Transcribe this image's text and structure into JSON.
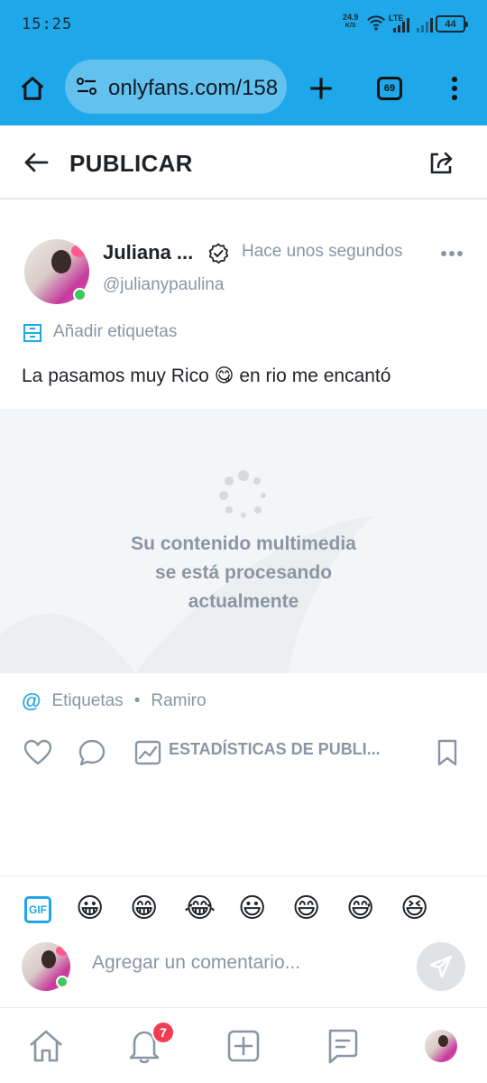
{
  "status_bar": {
    "time": "15:25",
    "net_speed": "24.9",
    "net_unit": "K/S",
    "network_type": "LTE",
    "battery": "44"
  },
  "browser": {
    "url": "onlyfans.com/158",
    "tab_count": "69",
    "icons": [
      "home-icon",
      "site-info-icon",
      "new-tab-icon",
      "tab-switcher-icon",
      "overflow-menu-icon"
    ]
  },
  "page": {
    "title": "PUBLICAR"
  },
  "post": {
    "author_name": "Juliana ...",
    "handle": "@julianypaulina",
    "time_ago": "Hace unos segundos",
    "add_tags_label": "Añadir etiquetas",
    "caption_before": "La pasamos muy Rico ",
    "caption_emoji": "😋",
    "caption_after": " en rio me encantó",
    "media_message_line1": "Su contenido multimedia",
    "media_message_line2": "se está procesando",
    "media_message_line3": "actualmente",
    "tags_label": "Etiquetas",
    "tagged_user": "Ramiro",
    "stats_label": "ESTADÍSTICAS DE PUBLI..."
  },
  "comment": {
    "gif_label": "GIF",
    "emojis": [
      "😀",
      "😁",
      "😂",
      "😃",
      "😄",
      "😅",
      "😆"
    ],
    "placeholder": "Agregar un comentario..."
  },
  "bottom_nav": {
    "notifications_badge": "7"
  },
  "colors": {
    "browser_bar": "#1ea7e9",
    "accent": "#1ea7e9",
    "muted_text": "#8a96a3",
    "online": "#3ec95b",
    "badge": "#ef3e54"
  }
}
